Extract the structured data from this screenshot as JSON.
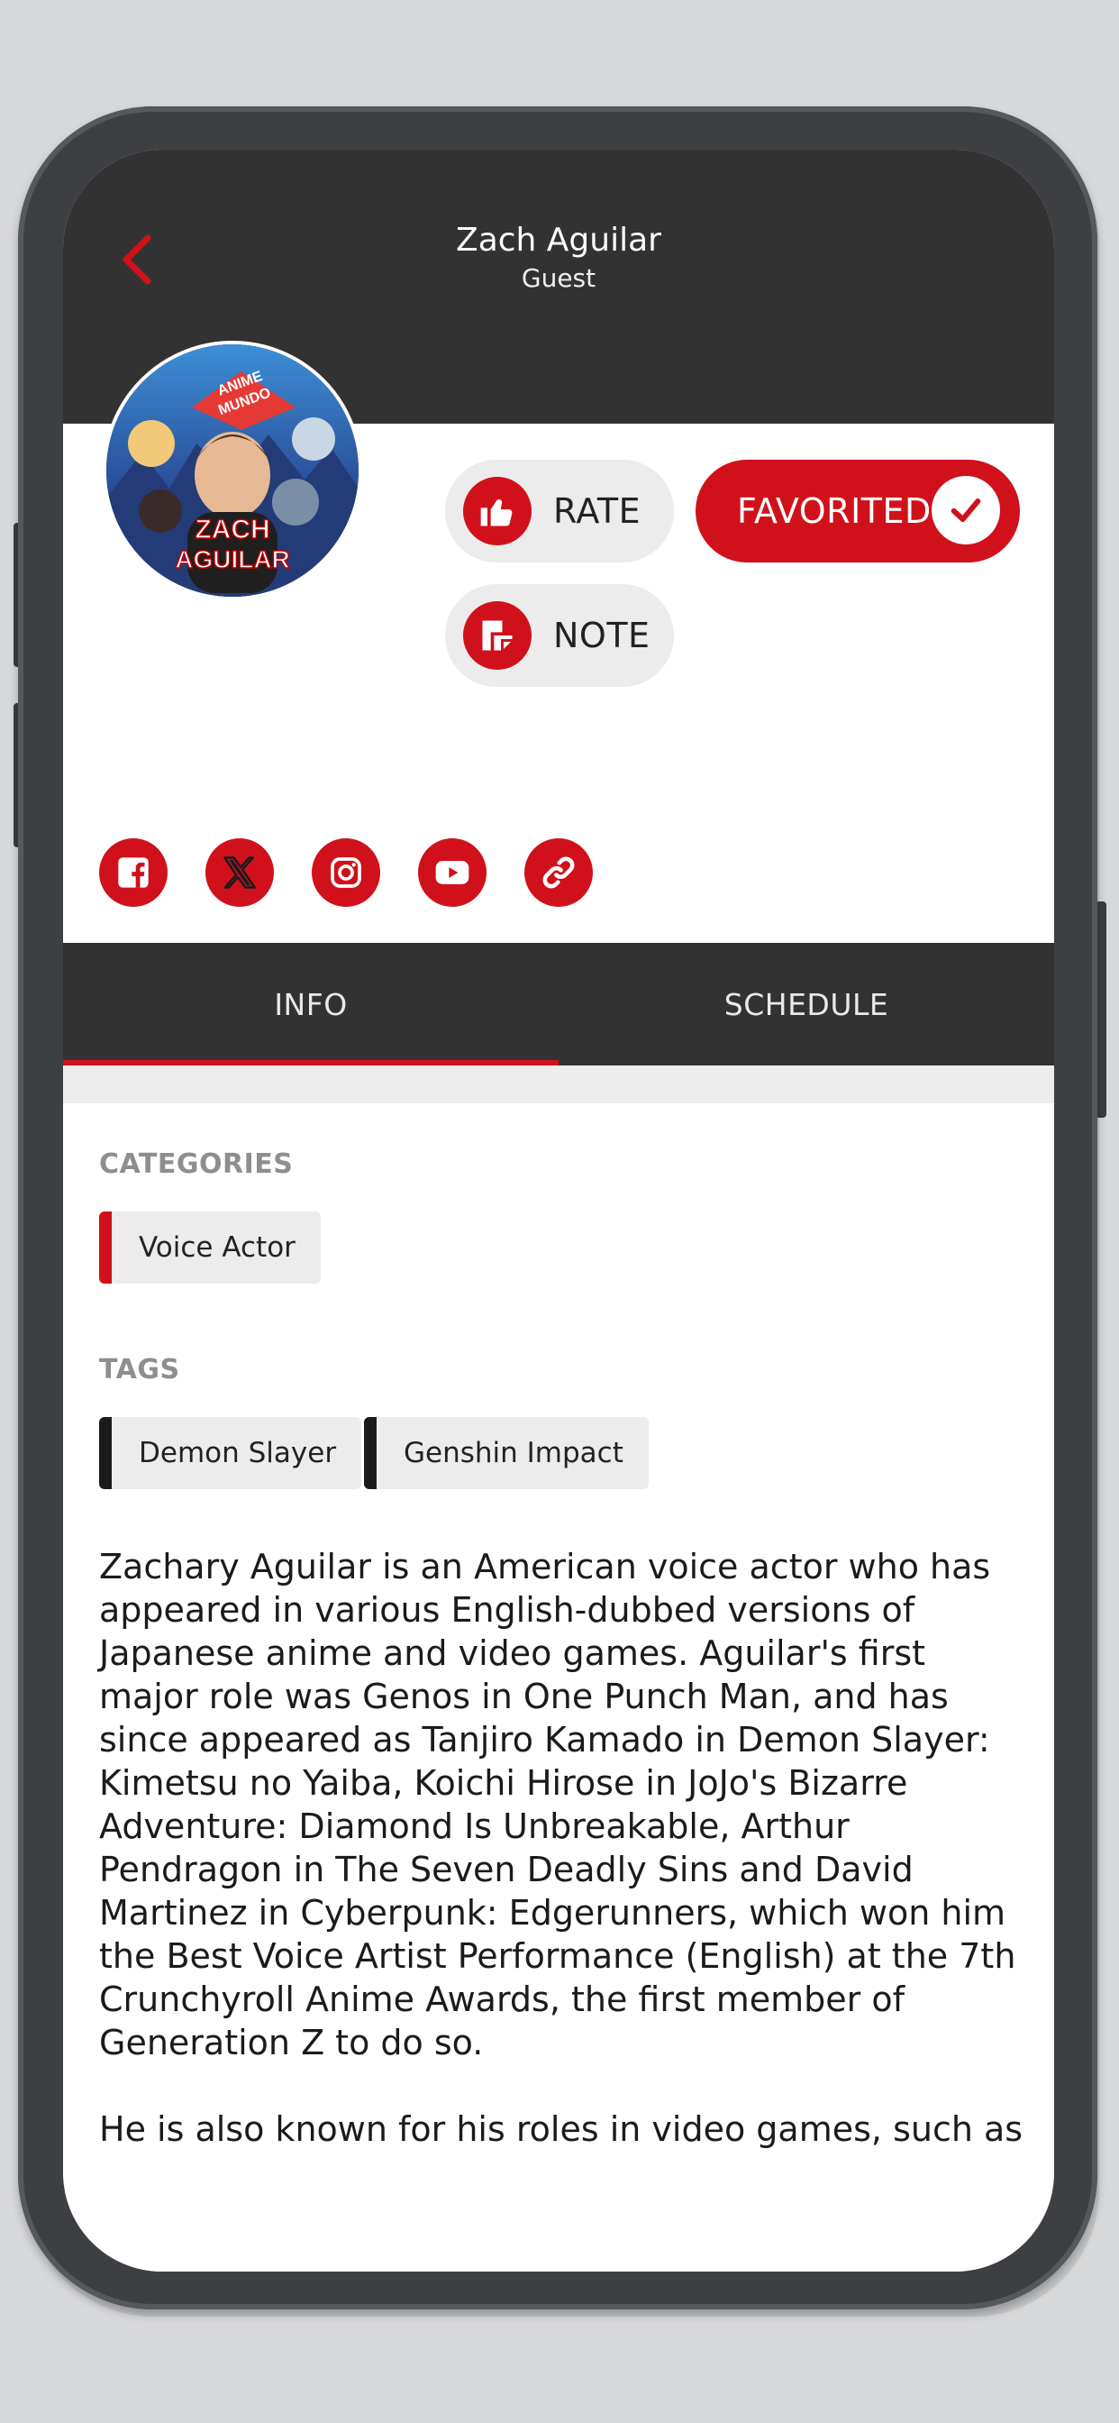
{
  "header": {
    "title": "Zach Aguilar",
    "subtitle": "Guest"
  },
  "avatar": {
    "brand_text": "ANIME MUNDO",
    "name_text": "ZACH AGUILAR"
  },
  "actions": {
    "rate_label": "RATE",
    "note_label": "NOTE",
    "favorite_label": "FAVORITED"
  },
  "social": [
    {
      "icon": "facebook-icon"
    },
    {
      "icon": "x-icon"
    },
    {
      "icon": "instagram-icon"
    },
    {
      "icon": "youtube-icon"
    },
    {
      "icon": "link-icon"
    }
  ],
  "tabs": [
    {
      "label": "INFO",
      "active": true
    },
    {
      "label": "SCHEDULE",
      "active": false
    }
  ],
  "info": {
    "categories_label": "CATEGORIES",
    "categories": [
      "Voice Actor"
    ],
    "tags_label": "TAGS",
    "tags": [
      "Demon Slayer",
      "Genshin Impact"
    ],
    "bio": [
      "Zachary Aguilar is an American voice actor who has appeared in various English-dubbed versions of Japanese anime and video games. Aguilar's first major role was Genos in One Punch Man, and has since appeared as Tanjiro Kamado in Demon Slayer: Kimetsu no Yaiba, Koichi Hirose in JoJo's Bizarre Adventure: Diamond Is Unbreakable, Arthur Pendragon in The Seven Deadly Sins and David Martinez in Cyberpunk: Edgerunners, which won him the Best Voice Artist Performance (English) at the 7th Crunchyroll Anime Awards, the first member of Generation Z to do so.",
      "He is also known for his roles in video games, such as Byleth Eisner in Fire Emblem: Three Houses, Aether"
    ]
  },
  "colors": {
    "accent": "#d0111b",
    "header_bg": "#323232",
    "chip_bg": "#ececec"
  }
}
